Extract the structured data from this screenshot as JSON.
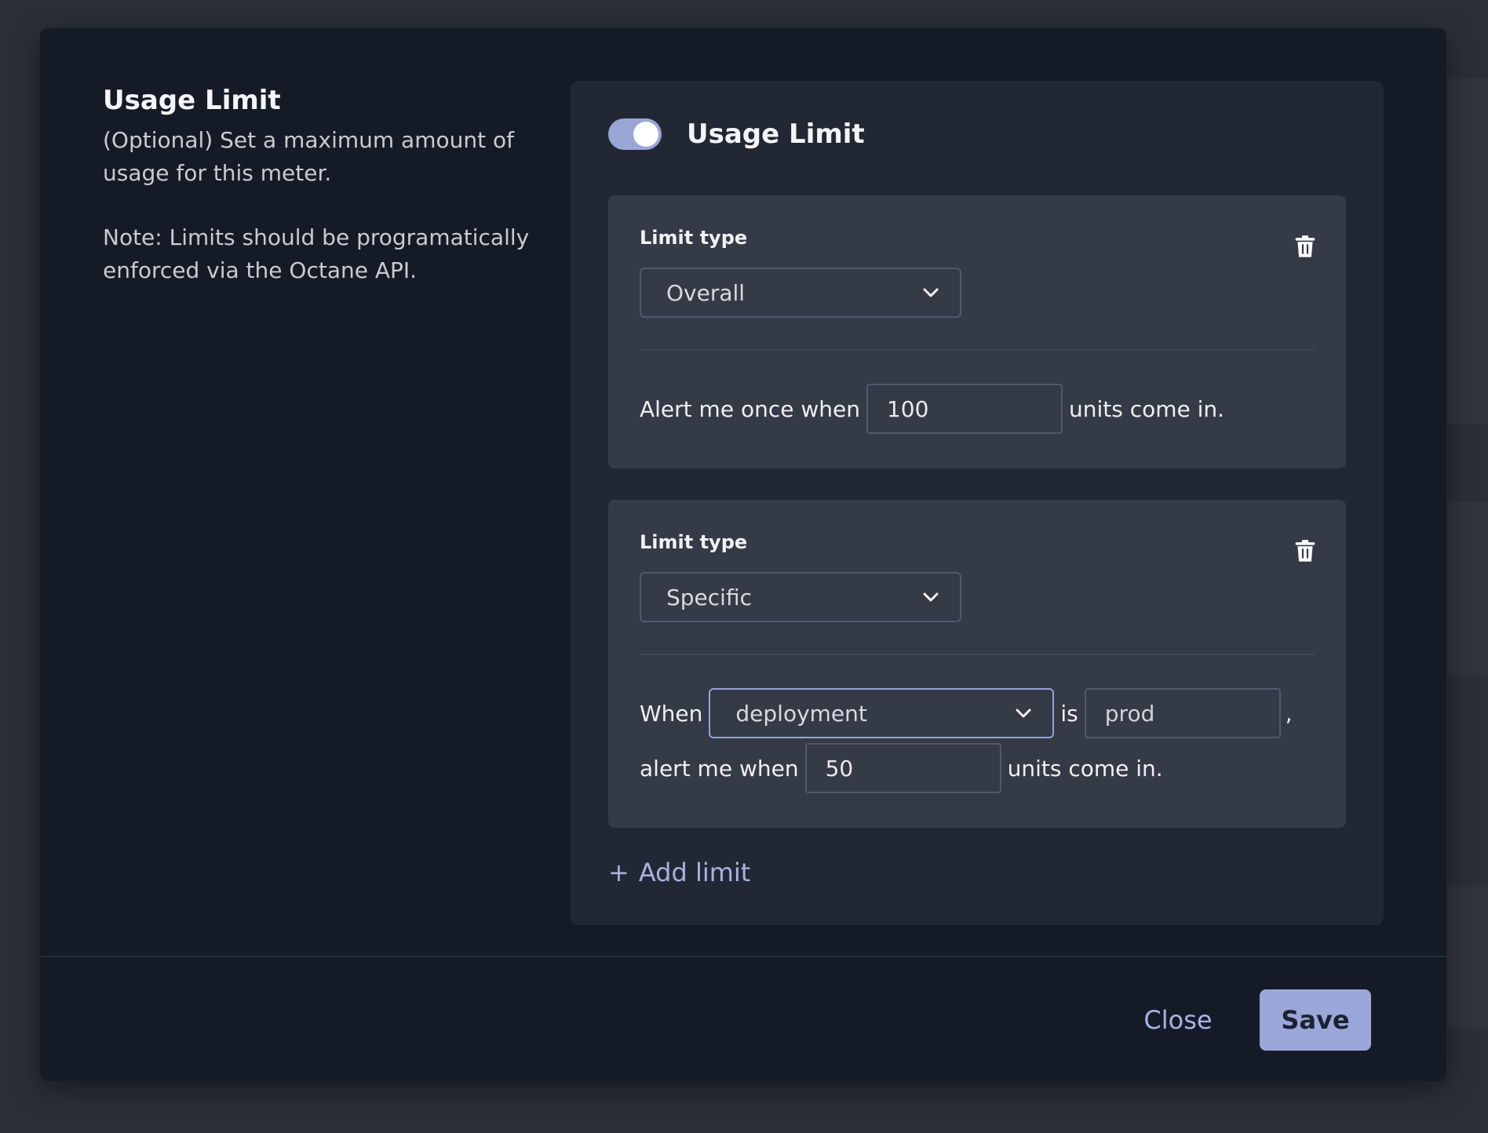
{
  "section": {
    "title": "Usage Limit",
    "description": "(Optional) Set a maximum amount of usage for this meter.",
    "note": "Note: Limits should be programatically enforced via the Octane API."
  },
  "toggle": {
    "label": "Usage Limit",
    "state": "on"
  },
  "limits": [
    {
      "type_label": "Limit type",
      "type_value": "Overall",
      "alert_prefix": "Alert me once when",
      "threshold": "100",
      "alert_suffix": "units come in.",
      "delete_icon": "trash-icon"
    },
    {
      "type_label": "Limit type",
      "type_value": "Specific",
      "when_label": "When",
      "field_value": "deployment",
      "is_label": "is",
      "match_value": "prod",
      "comma": ",",
      "alert_prefix": "alert me when",
      "threshold": "50",
      "alert_suffix": "units come in.",
      "delete_icon": "trash-icon"
    }
  ],
  "add_limit": {
    "icon": "+",
    "label": "Add limit"
  },
  "footer": {
    "close_label": "Close",
    "save_label": "Save"
  },
  "colors": {
    "accent": "#9ba7d8",
    "modal_bg": "#151b26",
    "panel_bg": "#222833",
    "card_bg": "#343a46"
  }
}
